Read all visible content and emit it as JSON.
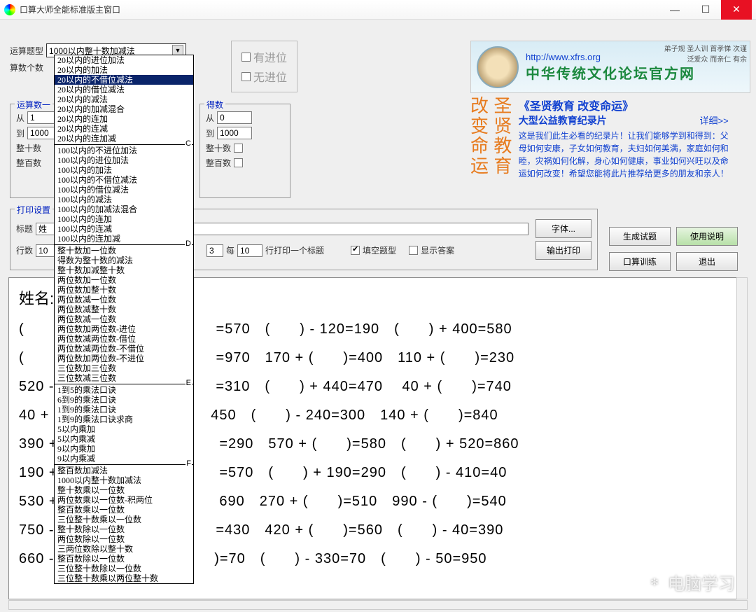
{
  "window": {
    "title": "口算大师全能标准版主窗口"
  },
  "top": {
    "type_label": "运算题型",
    "type_value": "1000以内整十数加减法",
    "count_label": "算数个数",
    "carry": "有进位",
    "nocarry": "无进位"
  },
  "range1": {
    "legend": "运算数一",
    "from_lbl": "从",
    "from": "1",
    "to_lbl": "到",
    "to": "1000",
    "tens": "整十数",
    "hundreds": "整百数"
  },
  "range2": {
    "legend": "得数",
    "from_lbl": "从",
    "from": "0",
    "to_lbl": "到",
    "to": "1000",
    "tens": "整十数",
    "hundreds": "整百数"
  },
  "print": {
    "legend": "打印设置",
    "title_lbl": "标题",
    "title_val": "姓",
    "rows_lbl": "行数",
    "rows_val": "10",
    "col_val": "3",
    "per_lbl": "每",
    "per_val": "10",
    "per_suffix": "行打印一个标题",
    "fill": "填空题型",
    "show_ans": "显示答案",
    "font_btn": "字体...",
    "output_btn": "输出打印"
  },
  "sidebtns": {
    "gen": "生成试题",
    "help": "使用说明",
    "train": "口算训练",
    "exit": "退出"
  },
  "banner": {
    "url": "http://www.xfrs.org",
    "title": "中华传统文化论坛官方网",
    "small": "弟子规 圣人训 首孝悌 次谨\n泛爱众 而亲仁 有余"
  },
  "promo": {
    "vert1": "改\n变\n命\n运",
    "vert2": "圣\n贤\n教\n育",
    "headline": "《圣贤教育 改变命运》",
    "sub": "大型公益教育纪录片",
    "more": "详细>>",
    "body": "这是我们此生必看的纪录片！让我们能够学到和得到：父母如何安康，子女如何教育，夫妇如何美满，家庭如何和睦，灾祸如何化解，身心如何健康，事业如何兴旺以及命运如何改变！希望您能将此片推荐给更多的朋友和亲人！"
  },
  "dropdown": {
    "selected_index": 2,
    "groups": [
      {
        "letter": "",
        "items": [
          "20以内的进位加法",
          "20以内的加法",
          "20以内的不借位减法",
          "20以内的借位减法",
          "20以内的减法",
          "20以内的加减混合",
          "20以内的连加",
          "20以内的连减",
          "20以内的连加减"
        ]
      },
      {
        "letter": "C",
        "items": [
          "100以内的不进位加法",
          "100以内的进位加法",
          "100以内的加法",
          "100以内的不借位减法",
          "100以内的借位减法",
          "100以内的减法",
          "100以内的加减法混合",
          "100以内的连加",
          "100以内的连减",
          "100以内的连加减"
        ]
      },
      {
        "letter": "D",
        "items": [
          "整十数加一位数",
          "得数为整十数的减法",
          "整十数加减整十数",
          "两位数加一位数",
          "两位数加整十数",
          "两位数减一位数",
          "两位数减整十数",
          "两位数减一位数",
          "两位数加两位数-进位",
          "两位数减两位数-借位",
          "两位数减两位数-不借位",
          "两位数加两位数-不进位",
          "三位数加三位数",
          "三位数减三位数"
        ]
      },
      {
        "letter": "E",
        "items": [
          "1到5的乘法口诀",
          "6到9的乘法口诀",
          "1到9的乘法口诀",
          "1到9的乘法口诀求商",
          "5以内乘加",
          "5以内乘减",
          "9以内乘加",
          "9以内乘减"
        ]
      },
      {
        "letter": "F",
        "items": [
          "整百数加减法",
          "1000以内整十数加减法",
          "整十数乘以一位数",
          "两位数乘以一位数-积两位",
          "整百数乘以一位数",
          "三位整十数乘以一位数",
          "整十数除以一位数",
          "两位数除以一位数",
          "三两位数除以整十数",
          "整百数除以一位数",
          "三位整十数除以一位数",
          "三位整十数乘以两位整十数"
        ]
      }
    ]
  },
  "worksheet": {
    "title": "姓名:",
    "rows": [
      "(　　) -　　　　　　　　　　=570　(　　) - 120=190　(　　) + 400=580",
      "(　　) -　　　　　　　　　　=970　170 + (　　)=400　110 + (　　)=230",
      "520 - (　　　　　　　　　　 =310　(　　) + 440=470　 40 + (　　)=740",
      " 40 + (　　　　　　　　　　 450　(　　) - 240=300　140 + (　　)=840",
      "390 + (　　　　　　　　　　 =290　570 + (　　)=580　(　　) + 520=860",
      "190 + (　　　　　　　　　　 =570　(　　) + 190=290　(　　) - 410=40",
      "530 + (　　　　　　　　　　 690　270 + (　　)=510　990 - (　　)=540",
      "750 - (　　　　　　　　　　 =430　420 + (　　)=560　(　　) - 40=390",
      "660 - (　　)=60　690 - (　　)=70　(　　) - 330=70　(　　) - 50=950"
    ]
  },
  "watermark": "电脑学习"
}
